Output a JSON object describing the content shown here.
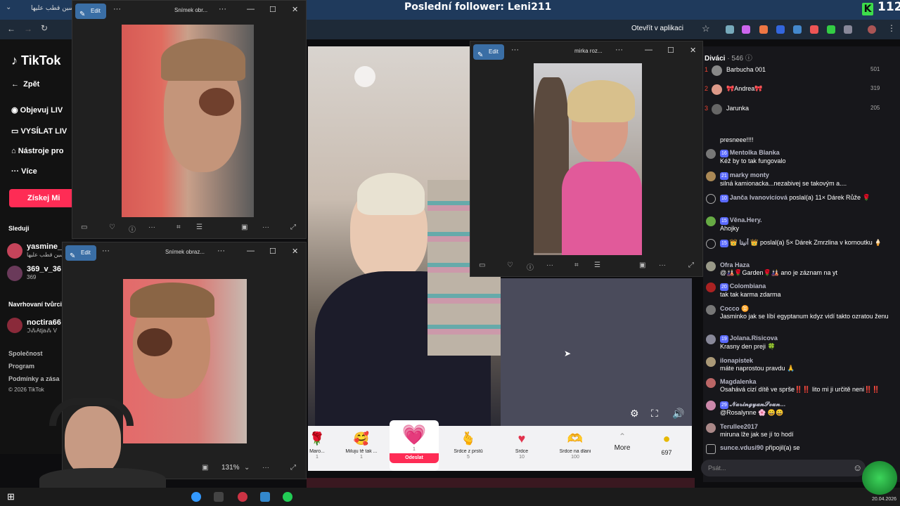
{
  "banner": {
    "title": "Poslední follower: Leni211",
    "count": "112",
    "k_icon": "K"
  },
  "browser": {
    "tab_title": "سين قطب عليها",
    "open_app": "Otevřít v aplikaci"
  },
  "sidebar": {
    "logo": "TikTok",
    "back": "Zpět",
    "explore": "Objevuj LIV",
    "go_live": "VYSÍLAT LIV",
    "tools": "Nástroje pro",
    "more": "Více",
    "coins_btn": "Získej Mi",
    "following_title": "Sleduji",
    "following": [
      {
        "name": "yasmine_",
        "sub": "سين قطب عليها"
      },
      {
        "name": "369_v_36",
        "sub": "369"
      }
    ],
    "suggested_title": "Navrhovaní tvůrci",
    "suggested": [
      {
        "name": "noctira66",
        "sub": "ℑ⁂Atja⁂ V"
      }
    ],
    "footer": [
      "Společnost",
      "Program",
      "Podmínky a zása",
      "© 2026 TikTok"
    ]
  },
  "win1": {
    "edit": "Edit",
    "title": "Snímek obr..."
  },
  "win2": {
    "edit": "Edit",
    "title": "Snímek obraz...",
    "zoom": "131%"
  },
  "win3": {
    "edit": "Edit",
    "title": "mirka roz..."
  },
  "giftbar": {
    "gifts": [
      {
        "label": "Maro...",
        "price": "1",
        "icon": "rose-icon"
      },
      {
        "label": "Miluju tě tak ...",
        "price": "1",
        "icon": "heart-face-icon"
      },
      {
        "label": "Odeslat",
        "price": "1",
        "icon": "heart-gift-icon"
      },
      {
        "label": "Srdce z prstů",
        "price": "5",
        "icon": "finger-heart-icon"
      },
      {
        "label": "Srdce",
        "price": "10",
        "icon": "heart-icon"
      },
      {
        "label": "Srdce na dlani",
        "price": "100",
        "icon": "palm-heart-icon"
      }
    ],
    "more": "More",
    "coins": "697"
  },
  "chat": {
    "viewers_title": "Diváci",
    "viewers_count": "· 546",
    "viewers": [
      {
        "rank": "1",
        "name": "Barbucha 001",
        "score": "501"
      },
      {
        "rank": "2",
        "name": "🎀Andrea🎀",
        "score": "319"
      },
      {
        "rank": "3",
        "name": "Jarunka",
        "score": "205"
      }
    ],
    "messages": [
      {
        "level": "",
        "name": "",
        "text": "presneee!!!!"
      },
      {
        "level": "16",
        "name": "Mentolka Blanka",
        "text": "Kéž by to tak fungovalo"
      },
      {
        "level": "21",
        "name": "marky monty",
        "text": "silná kamionacka...nezabivej se takovým a...."
      },
      {
        "level": "10",
        "name": "Janča Ivanovicíová",
        "text": "poslal(a) 11× Dárek Růže 🌹"
      },
      {
        "level": "15",
        "name": "Věna.Hery.",
        "text": "Ahojky"
      },
      {
        "level": "15",
        "name": "👑 أنيتا 👑",
        "text": "poslal(a) 5× Dárek Zmrzlina v kornoutku 🍦"
      },
      {
        "level": "",
        "name": "Ofra Haza",
        "text": "@🎎🌹Garden🌹🎎 ano je záznam na yt"
      },
      {
        "level": "20",
        "name": "Colombiana",
        "text": "tak tak karma zdarma"
      },
      {
        "level": "",
        "name": "Cocco ♊",
        "text": "Jasminko jak se líbí egyptanum kdyz vidí takto ozratou ženu"
      },
      {
        "level": "19",
        "name": "Jolana.Risicova",
        "text": "Krasny den preji 🍀"
      },
      {
        "level": "",
        "name": "ilonapistek",
        "text": "máte naprostou pravdu 🙏"
      },
      {
        "level": "",
        "name": "Magdalenka",
        "text": "Osahává cizí dítě ve sprše‼️‼️ lito mi ji určitě neni‼️‼️"
      },
      {
        "level": "29",
        "name": "𝓝𝓪𝓻𝓲𝓷𝓰𝔂𝓪𝓷𝓢𝓸𝓾𝓷...",
        "text": "@Rosalynne 🌸 😄😄"
      },
      {
        "level": "",
        "name": "Terullee2017",
        "text": "miruna lže jak se jí to hodí"
      },
      {
        "level": "",
        "name": "sunce.vdusi90",
        "text": "připojil(a) se"
      }
    ],
    "input_placeholder": "Psát...",
    "date": "20.04.2026"
  }
}
